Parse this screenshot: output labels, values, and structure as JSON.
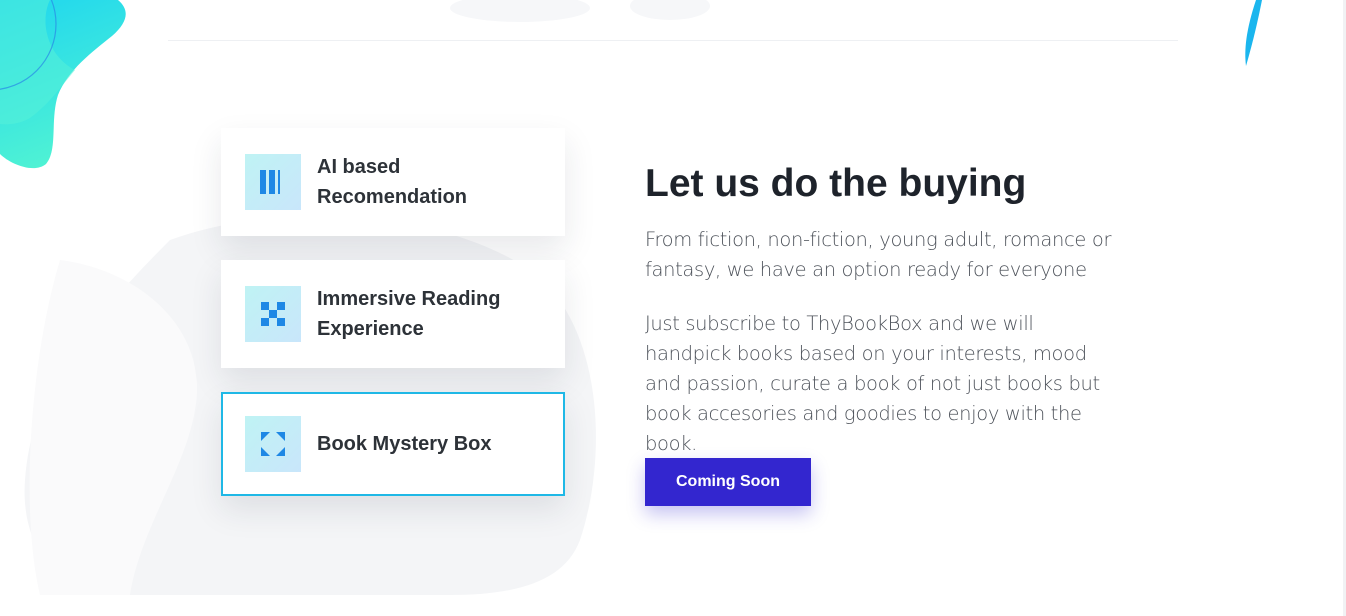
{
  "features": [
    {
      "label": "AI based Recomendation",
      "icon": "bars-icon",
      "active": false
    },
    {
      "label": "Immersive Reading Experience",
      "icon": "checker-grid-icon",
      "active": false
    },
    {
      "label": "Book Mystery Box",
      "icon": "expand-corners-icon",
      "active": true
    }
  ],
  "content": {
    "headline": "Let us do the buying",
    "paragraph_1": "From fiction, non-fiction, young adult, romance or fantasy, we have an option ready for everyone",
    "paragraph_2": "Just subscribe to ThyBookBox and we will handpick books based on your interests, mood and passion, curate a book of not just books but book accesories and goodies to enjoy with the book.",
    "cta_label": "Coming Soon"
  },
  "colors": {
    "accent": "#3326cf",
    "active_border": "#1fb8e6",
    "icon_blue": "#1e88e5",
    "blob_start": "#27d3ee",
    "blob_end": "#4af0d6"
  }
}
